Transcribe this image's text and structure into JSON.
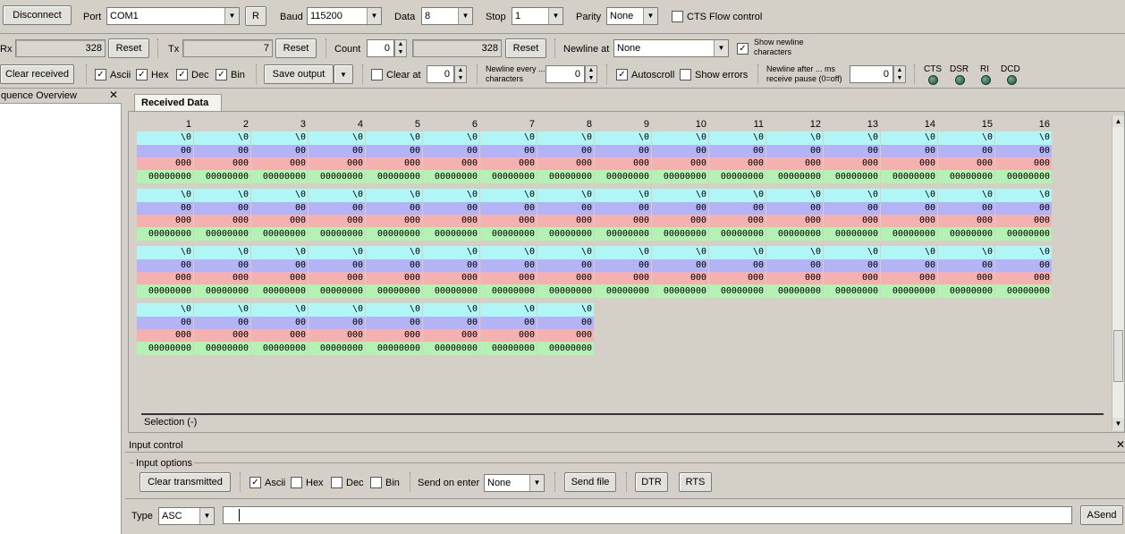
{
  "toolbar1": {
    "disconnect": "Disconnect",
    "port_label": "Port",
    "port_value": "COM1",
    "r_button": "R",
    "baud_label": "Baud",
    "baud_value": "115200",
    "data_label": "Data",
    "data_value": "8",
    "stop_label": "Stop",
    "stop_value": "1",
    "parity_label": "Parity",
    "parity_value": "None",
    "cts_flow_label": "CTS Flow control"
  },
  "toolbar2": {
    "rx_label": "Rx",
    "rx_value": "328",
    "rx_reset": "Reset",
    "tx_label": "Tx",
    "tx_value": "7",
    "tx_reset": "Reset",
    "count_label": "Count",
    "count_value": "0",
    "count_total": "328",
    "count_reset": "Reset",
    "newline_at_label": "Newline at",
    "newline_at_value": "None",
    "show_newline_label": "Show newline characters"
  },
  "toolbar3": {
    "clear_received": "Clear received",
    "ascii": "Ascii",
    "hex": "Hex",
    "dec": "Dec",
    "bin": "Bin",
    "save_output": "Save output",
    "clear_at": "Clear at",
    "clear_at_value": "0",
    "newline_every_label": "Newline every ... characters",
    "newline_every_value": "0",
    "autoscroll": "Autoscroll",
    "show_errors": "Show errors",
    "newline_after_label": "Newline after ... ms receive pause (0=off)",
    "newline_after_value": "0",
    "signals": [
      "CTS",
      "DSR",
      "RI",
      "DCD"
    ]
  },
  "sequence_panel": {
    "title": "quence Overview"
  },
  "received": {
    "tab": "Received Data",
    "columns": [
      "1",
      "2",
      "3",
      "4",
      "5",
      "6",
      "7",
      "8",
      "9",
      "10",
      "11",
      "12",
      "13",
      "14",
      "15",
      "16"
    ],
    "rows": [
      16,
      16,
      16,
      8
    ],
    "cell": {
      "ascii": "\\0",
      "hex": "00",
      "dec": "000",
      "bin": "00000000"
    },
    "selection": "Selection (-)"
  },
  "input_control": {
    "title": "Input control",
    "options_label": "Input options",
    "clear_transmitted": "Clear transmitted",
    "ascii": "Ascii",
    "hex": "Hex",
    "dec": "Dec",
    "bin": "Bin",
    "send_on_enter_label": "Send on enter",
    "send_on_enter_value": "None",
    "send_file": "Send file",
    "dtr": "DTR",
    "rts": "RTS",
    "type_label": "Type",
    "type_value": "ASC",
    "asend": "ASend"
  },
  "colors": {
    "ascii_bg": "#b0f6f6",
    "hex_bg": "#b3b3f5",
    "dec_bg": "#f5b0b0",
    "bin_bg": "#b3f2b3"
  }
}
